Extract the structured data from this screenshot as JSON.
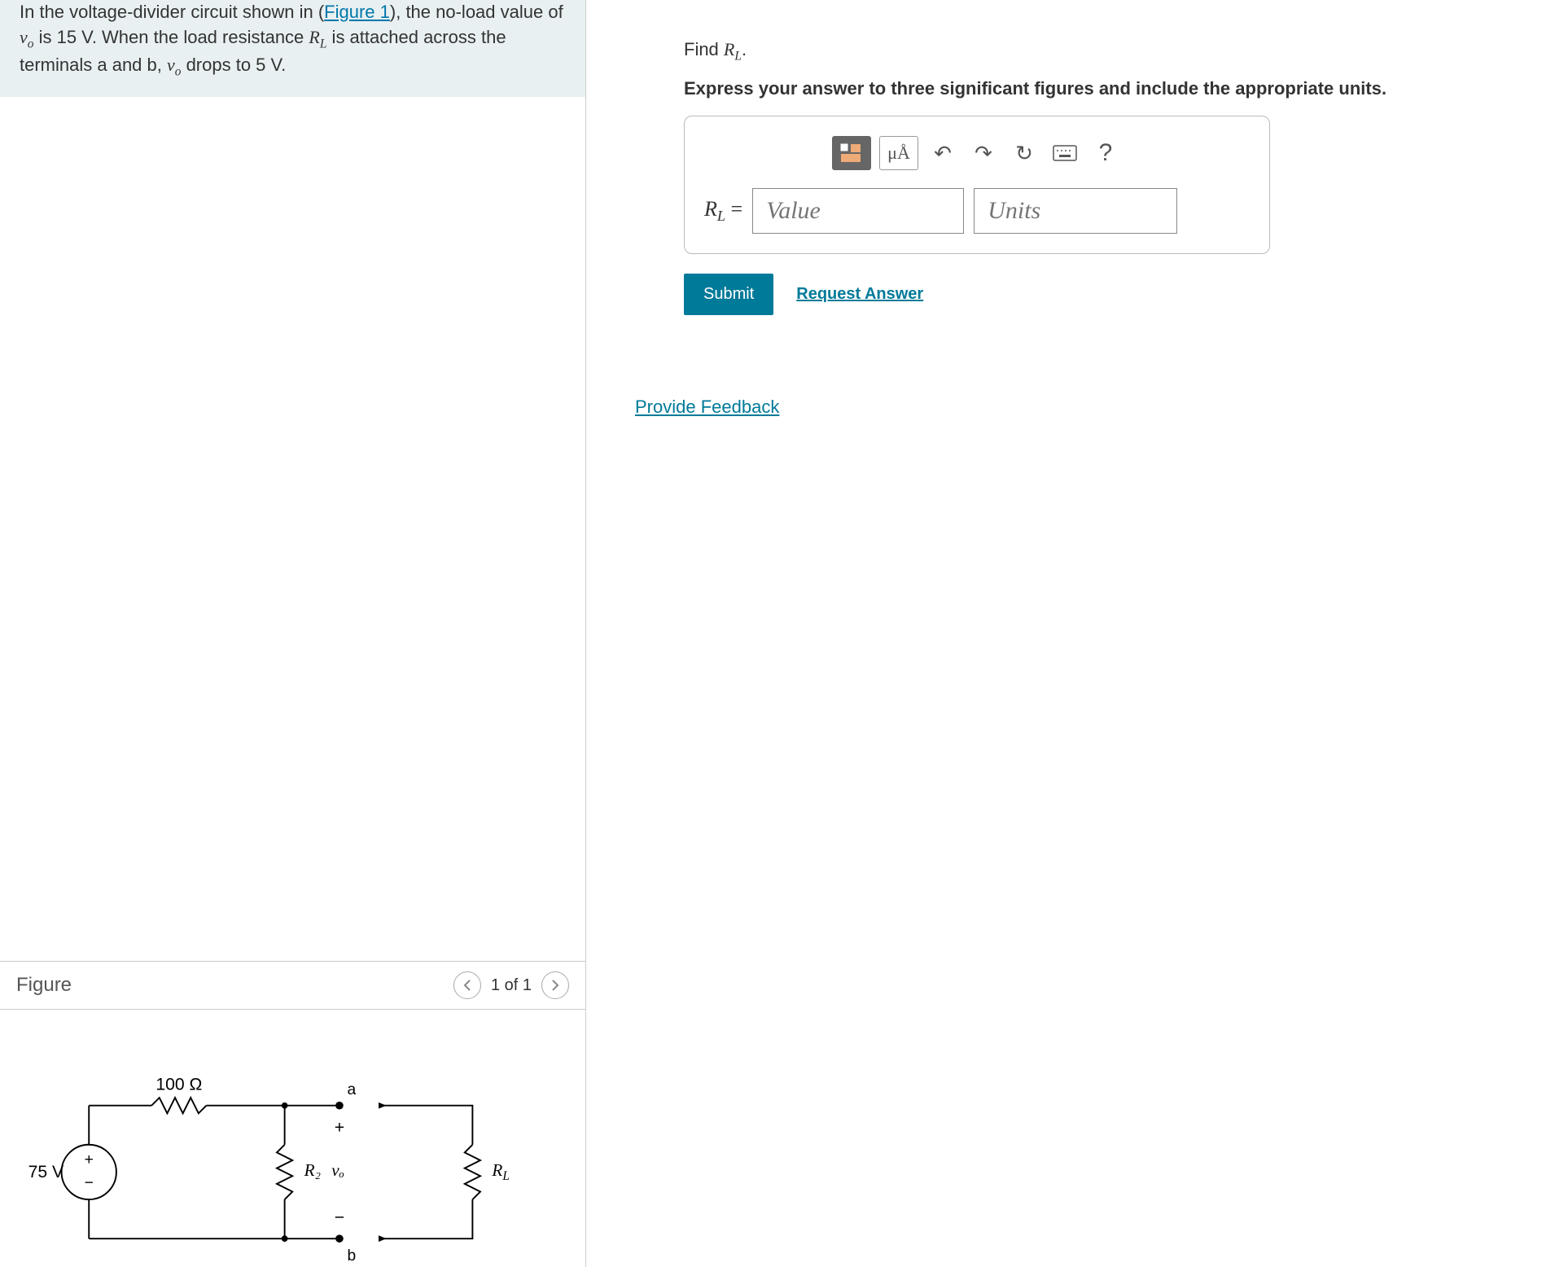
{
  "problem": {
    "text_pre": "In the voltage-divider circuit shown in (",
    "figure_link": "Figure 1",
    "text_post": "), the no-load value of ",
    "vo": "v",
    "vo_sub": "o",
    "text2": " is 15 V. When the load resistance ",
    "RL": "R",
    "RL_sub": "L",
    "text3": " is attached across the terminals a and b, ",
    "text4": " drops to 5 V."
  },
  "figure": {
    "title": "Figure",
    "pager": "1 of 1",
    "labels": {
      "r1": "100 Ω",
      "vs": "75 V",
      "r2": "R₂",
      "vo": "vₒ",
      "rl": "R",
      "rl_sub": "L",
      "node_a": "a",
      "node_b": "b"
    }
  },
  "question": {
    "prompt_pre": "Find ",
    "prompt_var": "R",
    "prompt_sub": "L",
    "prompt_post": ".",
    "subtext": "Express your answer to three significant figures and include the appropriate units.",
    "var_label_pre": "R",
    "var_label_sub": "L",
    "var_label_post": " =",
    "value_placeholder": "Value",
    "units_placeholder": "Units",
    "units_tool": "μÅ"
  },
  "buttons": {
    "submit": "Submit",
    "request": "Request Answer",
    "feedback": "Provide Feedback"
  }
}
